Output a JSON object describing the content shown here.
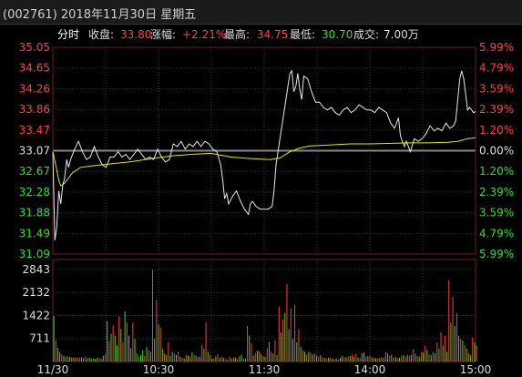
{
  "window": {
    "title": "(002761) 2018年11月30日 星期五"
  },
  "info_bar": {
    "mode": "分时",
    "close_label": "收盘:",
    "close_value": "33.80",
    "change_label": "涨幅:",
    "change_value": "+2.21%",
    "high_label": "最高:",
    "high_value": "34.75",
    "low_label": "最低:",
    "low_value": "30.70",
    "volume_label": "成交:",
    "volume_value": "7.00万"
  },
  "colors": {
    "up": "#ff4040",
    "down": "#33dd33",
    "neutral": "#dddddd",
    "price_line": "#e8e8e8",
    "avg_line": "#e6e600",
    "grid": "#333333"
  },
  "chart_data": {
    "type": "line",
    "prev_close": 33.07,
    "price_ticks": [
      "35.05",
      "34.65",
      "34.26",
      "33.86",
      "33.47",
      "33.07",
      "32.67",
      "32.28",
      "31.88",
      "31.49",
      "31.09"
    ],
    "pct_ticks": [
      "5.99%",
      "4.79%",
      "3.59%",
      "2.39%",
      "1.20%",
      "0.00%",
      "1.20%",
      "2.39%",
      "3.59%",
      "4.79%",
      "5.99%"
    ],
    "volume_ticks": [
      "2843",
      "2132",
      "1422",
      "711"
    ],
    "time_ticks": [
      "11/30",
      "10:30",
      "11:30",
      "14:00",
      "15:00"
    ],
    "ylim": [
      31.09,
      35.05
    ],
    "volume_ylim": [
      0,
      3150
    ],
    "series": [
      {
        "key": "price",
        "points": [
          [
            0,
            33.05
          ],
          [
            1,
            31.35
          ],
          [
            2,
            31.6
          ],
          [
            3,
            32.3
          ],
          [
            4,
            32.05
          ],
          [
            5,
            32.4
          ],
          [
            6,
            32.55
          ],
          [
            7,
            32.9
          ],
          [
            8,
            32.75
          ],
          [
            9,
            32.9
          ],
          [
            11,
            33.1
          ],
          [
            13,
            33.25
          ],
          [
            15,
            33.05
          ],
          [
            17,
            32.9
          ],
          [
            19,
            32.95
          ],
          [
            21,
            33.15
          ],
          [
            23,
            32.95
          ],
          [
            25,
            32.8
          ],
          [
            27,
            32.75
          ],
          [
            29,
            32.95
          ],
          [
            31,
            32.95
          ],
          [
            33,
            33.05
          ],
          [
            35,
            32.95
          ],
          [
            37,
            33.0
          ],
          [
            39,
            32.9
          ],
          [
            41,
            33.0
          ],
          [
            43,
            33.1
          ],
          [
            45,
            33.0
          ],
          [
            47,
            32.9
          ],
          [
            49,
            32.95
          ],
          [
            51,
            32.9
          ],
          [
            53,
            33.1
          ],
          [
            55,
            32.95
          ],
          [
            57,
            32.85
          ],
          [
            59,
            32.9
          ],
          [
            61,
            33.2
          ],
          [
            63,
            33.15
          ],
          [
            65,
            33.25
          ],
          [
            67,
            33.1
          ],
          [
            69,
            33.2
          ],
          [
            71,
            33.15
          ],
          [
            73,
            33.25
          ],
          [
            75,
            33.15
          ],
          [
            77,
            33.25
          ],
          [
            79,
            33.2
          ],
          [
            81,
            33.1
          ],
          [
            83,
            33.05
          ],
          [
            85,
            32.8
          ],
          [
            86,
            32.5
          ],
          [
            87,
            32.15
          ],
          [
            88,
            32.25
          ],
          [
            89,
            32.05
          ],
          [
            91,
            32.2
          ],
          [
            93,
            32.3
          ],
          [
            95,
            32.1
          ],
          [
            97,
            31.95
          ],
          [
            99,
            31.85
          ],
          [
            100,
            32.05
          ],
          [
            101,
            32.1
          ],
          [
            103,
            32.0
          ],
          [
            105,
            31.95
          ],
          [
            107,
            31.95
          ],
          [
            109,
            31.95
          ],
          [
            111,
            32.0
          ],
          [
            112,
            32.3
          ],
          [
            113,
            32.8
          ],
          [
            114,
            33.05
          ],
          [
            115,
            33.3
          ],
          [
            117,
            33.8
          ],
          [
            119,
            34.3
          ],
          [
            120,
            34.55
          ],
          [
            121,
            34.6
          ],
          [
            122,
            34.2
          ],
          [
            123,
            34.3
          ],
          [
            124,
            34.55
          ],
          [
            125,
            34.25
          ],
          [
            126,
            34.05
          ],
          [
            127,
            34.5
          ],
          [
            129,
            34.45
          ],
          [
            131,
            34.2
          ],
          [
            133,
            34.0
          ],
          [
            135,
            34.0
          ],
          [
            137,
            33.9
          ],
          [
            139,
            33.85
          ],
          [
            141,
            33.9
          ],
          [
            143,
            33.8
          ],
          [
            145,
            33.75
          ],
          [
            147,
            33.85
          ],
          [
            149,
            33.9
          ],
          [
            151,
            33.8
          ],
          [
            153,
            33.85
          ],
          [
            155,
            33.95
          ],
          [
            157,
            33.9
          ],
          [
            159,
            33.85
          ],
          [
            161,
            33.85
          ],
          [
            163,
            33.8
          ],
          [
            165,
            33.9
          ],
          [
            167,
            33.85
          ],
          [
            169,
            33.8
          ],
          [
            171,
            33.6
          ],
          [
            173,
            33.5
          ],
          [
            175,
            33.7
          ],
          [
            176,
            33.35
          ],
          [
            178,
            33.15
          ],
          [
            179,
            33.25
          ],
          [
            181,
            33.05
          ],
          [
            183,
            33.3
          ],
          [
            185,
            33.25
          ],
          [
            187,
            33.3
          ],
          [
            189,
            33.4
          ],
          [
            191,
            33.55
          ],
          [
            193,
            33.45
          ],
          [
            195,
            33.5
          ],
          [
            197,
            33.45
          ],
          [
            199,
            33.6
          ],
          [
            201,
            33.5
          ],
          [
            203,
            33.55
          ],
          [
            204,
            33.65
          ],
          [
            205,
            34.05
          ],
          [
            206,
            34.45
          ],
          [
            207,
            34.6
          ],
          [
            208,
            34.45
          ],
          [
            209,
            34.15
          ],
          [
            210,
            33.85
          ],
          [
            211,
            33.9
          ],
          [
            212,
            33.85
          ],
          [
            213,
            33.8
          ],
          [
            214,
            33.82
          ]
        ]
      },
      {
        "key": "average",
        "points": [
          [
            0,
            33.05
          ],
          [
            2,
            32.7
          ],
          [
            3,
            32.5
          ],
          [
            4,
            32.4
          ],
          [
            6,
            32.45
          ],
          [
            8,
            32.55
          ],
          [
            10,
            32.65
          ],
          [
            14,
            32.75
          ],
          [
            20,
            32.78
          ],
          [
            30,
            32.82
          ],
          [
            40,
            32.86
          ],
          [
            50,
            32.92
          ],
          [
            60,
            32.97
          ],
          [
            70,
            33.0
          ],
          [
            80,
            33.02
          ],
          [
            90,
            32.95
          ],
          [
            100,
            32.92
          ],
          [
            110,
            32.9
          ],
          [
            115,
            32.93
          ],
          [
            120,
            33.05
          ],
          [
            125,
            33.12
          ],
          [
            130,
            33.16
          ],
          [
            140,
            33.18
          ],
          [
            150,
            33.2
          ],
          [
            160,
            33.2
          ],
          [
            170,
            33.21
          ],
          [
            180,
            33.22
          ],
          [
            190,
            33.22
          ],
          [
            200,
            33.23
          ],
          [
            205,
            33.25
          ],
          [
            210,
            33.3
          ],
          [
            214,
            33.32
          ]
        ]
      }
    ],
    "volume": [
      [
        "d",
        1400
      ],
      [
        "u",
        650
      ],
      [
        "d",
        420
      ],
      [
        "d",
        300
      ],
      [
        "u",
        220
      ],
      [
        "d",
        180
      ],
      [
        "d",
        150
      ],
      [
        "u",
        160
      ],
      [
        "d",
        140
      ],
      [
        "u",
        130
      ],
      [
        "d",
        120
      ],
      [
        "u",
        140
      ],
      [
        "d",
        110
      ],
      [
        "u",
        120
      ],
      [
        "d",
        130
      ],
      [
        "d",
        100
      ],
      [
        "u",
        160
      ],
      [
        "d",
        110
      ],
      [
        "d",
        120
      ],
      [
        "d",
        90
      ],
      [
        "u",
        100
      ],
      [
        "d",
        80
      ],
      [
        "d",
        110
      ],
      [
        "u",
        120
      ],
      [
        "d",
        90
      ],
      [
        "d",
        180
      ],
      [
        "u",
        230
      ],
      [
        "d",
        1250
      ],
      [
        "u",
        620
      ],
      [
        "d",
        850
      ],
      [
        "u",
        1120
      ],
      [
        "d",
        800
      ],
      [
        "d",
        500
      ],
      [
        "u",
        1400
      ],
      [
        "d",
        1000
      ],
      [
        "u",
        600
      ],
      [
        "d",
        1550
      ],
      [
        "u",
        1200
      ],
      [
        "d",
        800
      ],
      [
        "d",
        400
      ],
      [
        "u",
        1200
      ],
      [
        "d",
        700
      ],
      [
        "d",
        250
      ],
      [
        "u",
        150
      ],
      [
        "d",
        200
      ],
      [
        "d",
        350
      ],
      [
        "u",
        180
      ],
      [
        "d",
        450
      ],
      [
        "u",
        350
      ],
      [
        "d",
        300
      ],
      [
        "u",
        2843
      ],
      [
        "d",
        700
      ],
      [
        "u",
        1900
      ],
      [
        "d",
        1150
      ],
      [
        "u",
        1050
      ],
      [
        "d",
        400
      ],
      [
        "u",
        250
      ],
      [
        "d",
        200
      ],
      [
        "u",
        600
      ],
      [
        "d",
        180
      ],
      [
        "d",
        300
      ],
      [
        "u",
        250
      ],
      [
        "d",
        200
      ],
      [
        "u",
        300
      ],
      [
        "d",
        150
      ],
      [
        "u",
        120
      ],
      [
        "d",
        100
      ],
      [
        "u",
        200
      ],
      [
        "d",
        180
      ],
      [
        "u",
        160
      ],
      [
        "d",
        280
      ],
      [
        "u",
        220
      ],
      [
        "d",
        180
      ],
      [
        "u",
        150
      ],
      [
        "d",
        150
      ],
      [
        "u",
        520
      ],
      [
        "d",
        400
      ],
      [
        "u",
        1200
      ],
      [
        "d",
        300
      ],
      [
        "u",
        200
      ],
      [
        "d",
        80
      ],
      [
        "u",
        100
      ],
      [
        "d",
        160
      ],
      [
        "u",
        230
      ],
      [
        "d",
        120
      ],
      [
        "u",
        150
      ],
      [
        "d",
        110
      ],
      [
        "u",
        80
      ],
      [
        "d",
        60
      ],
      [
        "u",
        150
      ],
      [
        "d",
        90
      ],
      [
        "u",
        130
      ],
      [
        "d",
        120
      ],
      [
        "u",
        70
      ],
      [
        "d",
        160
      ],
      [
        "d",
        220
      ],
      [
        "u",
        100
      ],
      [
        "d",
        90
      ],
      [
        "u",
        1100
      ],
      [
        "d",
        800
      ],
      [
        "u",
        550
      ],
      [
        "d",
        180
      ],
      [
        "u",
        260
      ],
      [
        "d",
        330
      ],
      [
        "u",
        320
      ],
      [
        "d",
        230
      ],
      [
        "u",
        160
      ],
      [
        "d",
        150
      ],
      [
        "u",
        400
      ],
      [
        "d",
        600
      ],
      [
        "u",
        300
      ],
      [
        "d",
        250
      ],
      [
        "u",
        650
      ],
      [
        "d",
        200
      ],
      [
        "u",
        1700
      ],
      [
        "d",
        900
      ],
      [
        "u",
        1300
      ],
      [
        "d",
        1500
      ],
      [
        "u",
        2400
      ],
      [
        "d",
        1000
      ],
      [
        "u",
        1650
      ],
      [
        "d",
        700
      ],
      [
        "u",
        1750
      ],
      [
        "d",
        600
      ],
      [
        "u",
        1000
      ],
      [
        "d",
        450
      ],
      [
        "u",
        350
      ],
      [
        "d",
        300
      ],
      [
        "u",
        200
      ],
      [
        "d",
        300
      ],
      [
        "u",
        280
      ],
      [
        "d",
        220
      ],
      [
        "u",
        240
      ],
      [
        "d",
        180
      ],
      [
        "u",
        150
      ],
      [
        "d",
        200
      ],
      [
        "u",
        130
      ],
      [
        "d",
        110
      ],
      [
        "u",
        100
      ],
      [
        "d",
        120
      ],
      [
        "u",
        130
      ],
      [
        "d",
        90
      ],
      [
        "u",
        80
      ],
      [
        "d",
        100
      ],
      [
        "u",
        70
      ],
      [
        "d",
        120
      ],
      [
        "d",
        180
      ],
      [
        "u",
        140
      ],
      [
        "d",
        130
      ],
      [
        "u",
        160
      ],
      [
        "d",
        170
      ],
      [
        "u",
        210
      ],
      [
        "d",
        150
      ],
      [
        "u",
        240
      ],
      [
        "d",
        130
      ],
      [
        "u",
        120
      ],
      [
        "d",
        250
      ],
      [
        "d",
        280
      ],
      [
        "u",
        150
      ],
      [
        "d",
        170
      ],
      [
        "u",
        180
      ],
      [
        "d",
        130
      ],
      [
        "u",
        120
      ],
      [
        "d",
        100
      ],
      [
        "u",
        90
      ],
      [
        "d",
        110
      ],
      [
        "u",
        140
      ],
      [
        "d",
        120
      ],
      [
        "u",
        300
      ],
      [
        "d",
        250
      ],
      [
        "u",
        180
      ],
      [
        "d",
        210
      ],
      [
        "u",
        120
      ],
      [
        "d",
        140
      ],
      [
        "u",
        100
      ],
      [
        "d",
        120
      ],
      [
        "u",
        170
      ],
      [
        "d",
        190
      ],
      [
        "u",
        160
      ],
      [
        "d",
        210
      ],
      [
        "u",
        180
      ],
      [
        "d",
        200
      ],
      [
        "u",
        380
      ],
      [
        "d",
        250
      ],
      [
        "u",
        170
      ],
      [
        "d",
        150
      ],
      [
        "u",
        300
      ],
      [
        "d",
        280
      ],
      [
        "u",
        480
      ],
      [
        "d",
        350
      ],
      [
        "u",
        230
      ],
      [
        "d",
        200
      ],
      [
        "u",
        300
      ],
      [
        "d",
        250
      ],
      [
        "u",
        600
      ],
      [
        "d",
        400
      ],
      [
        "u",
        900
      ],
      [
        "d",
        500
      ],
      [
        "u",
        800
      ],
      [
        "d",
        300
      ],
      [
        "u",
        2500
      ],
      [
        "d",
        1200
      ],
      [
        "u",
        2000
      ],
      [
        "d",
        1100
      ],
      [
        "u",
        1500
      ],
      [
        "d",
        800
      ],
      [
        "u",
        700
      ],
      [
        "d",
        650
      ],
      [
        "u",
        500
      ],
      [
        "d",
        400
      ],
      [
        "u",
        250
      ],
      [
        "d",
        200
      ],
      [
        "u",
        750
      ],
      [
        "d",
        600
      ],
      [
        "u",
        500
      ]
    ]
  }
}
